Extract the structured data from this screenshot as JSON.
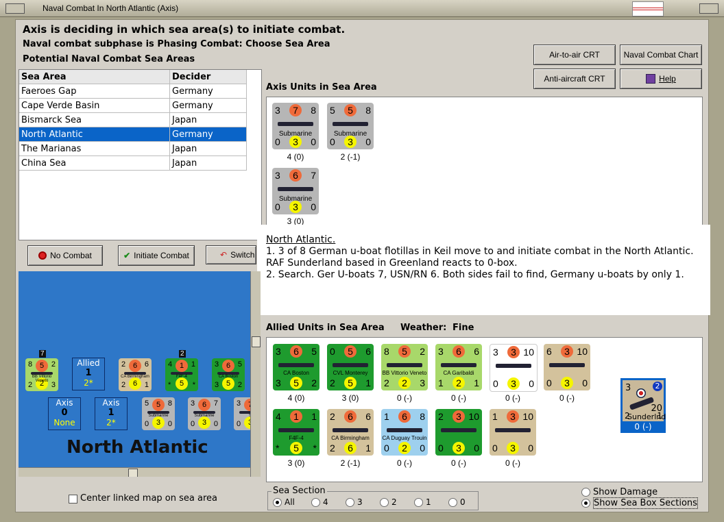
{
  "window": {
    "title": "Naval Combat In North Atlantic (Axis)"
  },
  "header": {
    "line1": "Axis is deciding in which sea area(s) to initiate combat.",
    "line2": "Naval combat subphase is Phasing Combat: Choose Sea Area",
    "line3": "Potential Naval Combat Sea Areas"
  },
  "buttons": {
    "air_crt": "Air-to-air CRT",
    "naval_chart": "Naval Combat Chart",
    "aa_crt": "Anti-aircraft CRT",
    "help": "Help",
    "no_combat": "No Combat",
    "initiate": "Initiate Combat",
    "switch": "Switch"
  },
  "table": {
    "headers": [
      "Sea Area",
      "Decider"
    ],
    "rows": [
      [
        "Faeroes Gap",
        "Germany"
      ],
      [
        "Cape Verde Basin",
        "Germany"
      ],
      [
        "Bismarck Sea",
        "Japan"
      ],
      [
        "North Atlantic",
        "Germany"
      ],
      [
        "The Marianas",
        "Japan"
      ],
      [
        "China Sea",
        "Japan"
      ]
    ],
    "selected_index": 3
  },
  "axis_panel": {
    "title": "Axis Units in Sea Area",
    "units": [
      {
        "tl": "3",
        "tc": "7",
        "tr": "8",
        "name": "Submarine",
        "bl": "0",
        "bc": "3",
        "br": "0",
        "caption": "4 (0)"
      },
      {
        "tl": "5",
        "tc": "5",
        "tr": "8",
        "name": "Submarine",
        "bl": "0",
        "bc": "3",
        "br": "0",
        "caption": "2 (-1)"
      },
      {
        "tl": "3",
        "tc": "6",
        "tr": "7",
        "name": "Submarine",
        "bl": "0",
        "bc": "3",
        "br": "0",
        "caption": "3 (0)"
      }
    ]
  },
  "note": {
    "title": "North Atlantic.",
    "p1": "1. 3 of 8  German u-boat flotillas in Keil move to and initiate combat in the North Atlantic.  RAF Sunderland based in Greenland reacts to 0-box.",
    "p2": "2. Search.  Ger U-boats 7, USN/RN 6.  Both sides fail to find, Germany u-boats by only 1."
  },
  "allied_panel": {
    "title": "Allied Units in Sea Area",
    "weather_label": "Weather:",
    "weather": "Fine",
    "row1": [
      {
        "tl": "3",
        "tc": "6",
        "tr": "5",
        "name": "CA Boston",
        "bl": "3",
        "bc": "5",
        "br": "2",
        "caption": "4 (0)",
        "color": "green"
      },
      {
        "tl": "0",
        "tc": "5",
        "tr": "6",
        "name": "CVL Monterey",
        "bl": "2",
        "bc": "5",
        "br": "1",
        "caption": "3 (0)",
        "color": "green"
      },
      {
        "tl": "8",
        "tc": "5",
        "tr": "2",
        "name": "BB Vittorio Veneto",
        "bl": "2",
        "bc": "2",
        "br": "3",
        "caption": "0 (-)",
        "color": "lgreen"
      },
      {
        "tl": "3",
        "tc": "6",
        "tr": "6",
        "name": "CA Garibaldi",
        "bl": "1",
        "bc": "2",
        "br": "1",
        "caption": "0 (-)",
        "color": "lgreen"
      },
      {
        "tl": "3",
        "tc": "3",
        "tr": "10",
        "name": "",
        "bl": "0",
        "bc": "3",
        "br": "0",
        "caption": "0 (-)",
        "color": "white"
      },
      {
        "tl": "6",
        "tc": "3",
        "tr": "10",
        "name": "",
        "bl": "0",
        "bc": "3",
        "br": "0",
        "caption": "0 (-)",
        "color": "tan"
      }
    ],
    "row2": [
      {
        "tl": "4",
        "tc": "1",
        "tr": "1",
        "name": "F4F-4",
        "bl": "*",
        "bc": "5",
        "br": "*",
        "caption": "3 (0)",
        "color": "green"
      },
      {
        "tl": "2",
        "tc": "6",
        "tr": "6",
        "name": "CA Birmingham",
        "bl": "2",
        "bc": "6",
        "br": "1",
        "caption": "2 (-1)",
        "color": "tan"
      },
      {
        "tl": "1",
        "tc": "6",
        "tr": "8",
        "name": "CA Duguay Trouin",
        "bl": "0",
        "bc": "2",
        "br": "0",
        "caption": "0 (-)",
        "color": "lblue"
      },
      {
        "tl": "2",
        "tc": "3",
        "tr": "10",
        "name": "",
        "bl": "0",
        "bc": "3",
        "br": "0",
        "caption": "0 (-)",
        "color": "green"
      },
      {
        "tl": "1",
        "tc": "3",
        "tr": "10",
        "name": "",
        "bl": "0",
        "bc": "3",
        "br": "0",
        "caption": "0 (-)",
        "color": "tan"
      }
    ],
    "sunderland": {
      "tl": "3",
      "tr": "2",
      "mid": "20",
      "bl": "2",
      "br": "1",
      "name": "Sunderlnd",
      "caption": "0 (-)"
    }
  },
  "map": {
    "sea_name": "North Atlantic",
    "allied_label": "Allied",
    "allied_count": "1",
    "allied_sub": "2*",
    "axis_label1": "Axis",
    "axis_count1": "0",
    "axis_sub1": "None",
    "axis_label2": "Axis",
    "axis_count2": "1",
    "axis_sub2": "2*",
    "top_counters": [
      {
        "badge": "7",
        "tl": "8",
        "tc": "5",
        "tr": "2",
        "name": "BB Vittorio Veneto",
        "bl": "2",
        "bc": "2",
        "br": "3",
        "color": "lgreen"
      },
      {
        "tl": "2",
        "tc": "6",
        "tr": "6",
        "name": "CA Birmingham",
        "bl": "2",
        "bc": "6",
        "br": "1",
        "color": "tan"
      },
      {
        "badge": "2",
        "tl": "4",
        "tc": "1",
        "tr": "1",
        "name": "F4F-4",
        "bl": "*",
        "bc": "5",
        "br": "*",
        "color": "green"
      },
      {
        "tl": "3",
        "tc": "6",
        "tr": "5",
        "name": "CA Boston",
        "bl": "3",
        "bc": "5",
        "br": "2",
        "color": "green"
      }
    ],
    "sub_counters": [
      {
        "tl": "5",
        "tc": "5",
        "tr": "8",
        "name": "Submarine",
        "bl": "0",
        "bc": "3",
        "br": "0"
      },
      {
        "tl": "3",
        "tc": "6",
        "tr": "7",
        "name": "Submarine",
        "bl": "0",
        "bc": "3",
        "br": "0"
      },
      {
        "tl": "3",
        "tc": "7",
        "tr": "",
        "name": "S",
        "bl": "0",
        "bc": "3",
        "br": ""
      }
    ],
    "center_checkbox": "Center linked map on sea area"
  },
  "sea_section": {
    "label": "Sea Section",
    "options": [
      "All",
      "4",
      "3",
      "2",
      "1",
      "0"
    ],
    "selected": "All"
  },
  "view_options": {
    "show_damage": "Show Damage",
    "show_sections": "Show Sea Box Sections"
  }
}
